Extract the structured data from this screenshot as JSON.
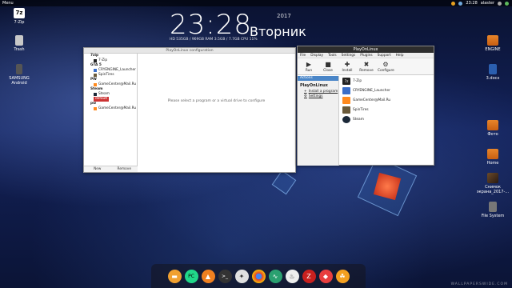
{
  "top_panel": {
    "menu": "Menu",
    "time": "23:28",
    "user": "alaster"
  },
  "clock": {
    "time": "23:28",
    "year": "2017",
    "day": "Вторник",
    "stats": "HD 535GB / 969GB   RAM 3.5GB / 7.7GB   CPU 11%"
  },
  "desktop_left": [
    {
      "label": "7-Zip",
      "icon": "seven-zip-icon",
      "color": "#ffffff"
    },
    {
      "label": "Trash",
      "icon": "trash-icon",
      "color": "#d0d0d0"
    },
    {
      "label": "SAMSUNG Android",
      "icon": "phone-icon",
      "color": "#7a7a7a"
    }
  ],
  "desktop_right": [
    {
      "label": "ENGINE",
      "icon": "folder-icon"
    },
    {
      "label": "3.docx",
      "icon": "document-icon"
    },
    {
      "label": "Фото",
      "icon": "folder-icon"
    },
    {
      "label": "Home",
      "icon": "folder-icon"
    },
    {
      "label": "Снимок экрана_2017-...",
      "icon": "screenshot-icon"
    },
    {
      "label": "File System",
      "icon": "drive-icon"
    }
  ],
  "config_window": {
    "title": "PlayOnLinux configuration",
    "message": "Please select a program or a virtual drive to configure",
    "new_label": "New",
    "remove_label": "Remove",
    "tree": [
      {
        "group": "7zip",
        "items": [
          "7-Zip"
        ]
      },
      {
        "group": "GTA 5",
        "items": [
          "CRYENGINE_Launcher",
          "SpinTires"
        ]
      },
      {
        "group": "PW",
        "items": [
          "GameCenter@Mail.Ru"
        ]
      },
      {
        "group": "Steam",
        "items": [
          "Steam",
          "default"
        ]
      },
      {
        "group": "pw",
        "items": [
          "GameCenter@Mail.Ru"
        ]
      }
    ],
    "selected_item": "default"
  },
  "pol_window": {
    "title": "PlayOnLinux",
    "menu": [
      "File",
      "Display",
      "Tools",
      "Settings",
      "Plugins",
      "Support",
      "Help"
    ],
    "toolbar": [
      {
        "label": "Run",
        "icon": "play-icon"
      },
      {
        "label": "Close",
        "icon": "stop-icon"
      },
      {
        "label": "Install",
        "icon": "plus-icon"
      },
      {
        "label": "Remove",
        "icon": "x-icon"
      },
      {
        "label": "Configure",
        "icon": "gear-icon"
      }
    ],
    "actions_header": "Actions",
    "section": "PlayOnLinux",
    "links": [
      "Install a program",
      "Settings"
    ],
    "apps": [
      {
        "name": "7-Zip",
        "color": "#222222"
      },
      {
        "name": "CRYENGINE_Launcher",
        "color": "#3a6ec8"
      },
      {
        "name": "GameCenter@Mail.Ru",
        "color": "#ff8a1e"
      },
      {
        "name": "SpinTires",
        "color": "#6a5a3a"
      },
      {
        "name": "Steam",
        "color": "#1b2838"
      }
    ]
  },
  "dock": [
    {
      "name": "files-app",
      "color": "#f0a030",
      "glyph": "▬"
    },
    {
      "name": "pycharm-app",
      "color": "#21d789",
      "glyph": "PC"
    },
    {
      "name": "vlc-app",
      "color": "#f08020",
      "glyph": "▲"
    },
    {
      "name": "terminal-app",
      "color": "#333333",
      "glyph": ">_"
    },
    {
      "name": "settings-app",
      "color": "#e0e0e0",
      "glyph": "✦"
    },
    {
      "name": "chrome-app",
      "color": "#e04030",
      "glyph": "●"
    },
    {
      "name": "monitor-app",
      "color": "#2aa070",
      "glyph": "∿"
    },
    {
      "name": "steam-app",
      "color": "#eeeeee",
      "glyph": "♨"
    },
    {
      "name": "filezilla-app",
      "color": "#c8201e",
      "glyph": "Z"
    },
    {
      "name": "anydesk-app",
      "color": "#e83e3e",
      "glyph": "◆"
    },
    {
      "name": "playonlinux-app",
      "color": "#f4a020",
      "glyph": "☘"
    }
  ],
  "watermark": "WALLPAPERSWIDE.COM"
}
